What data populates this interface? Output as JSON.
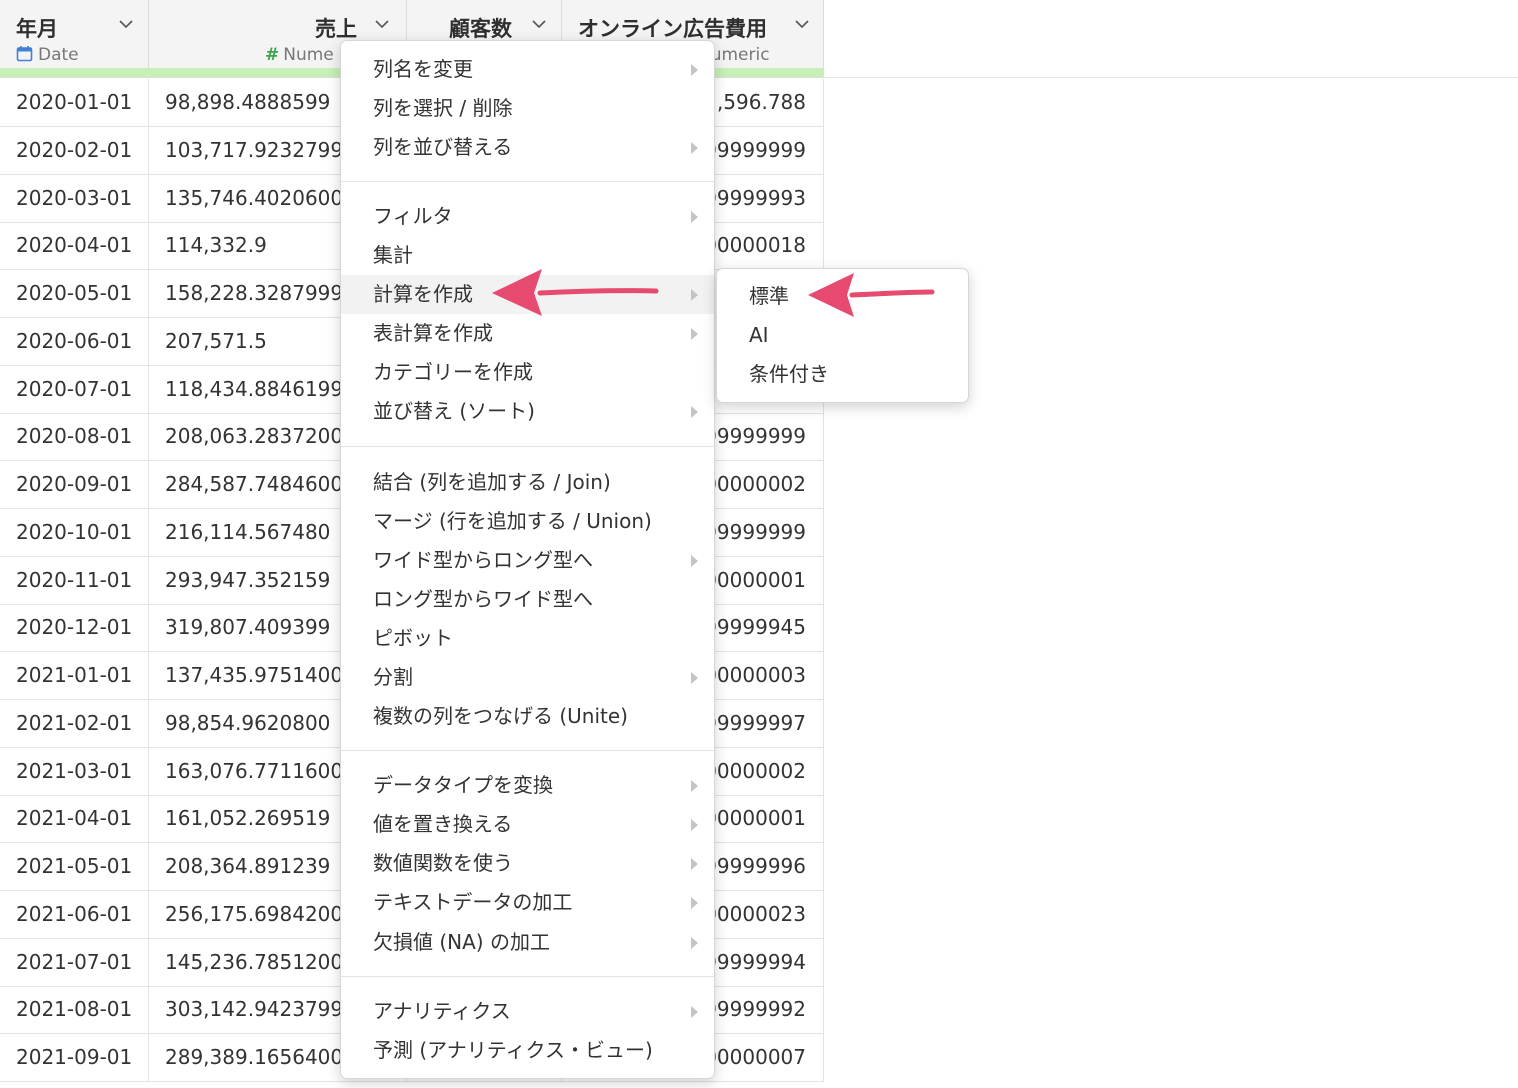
{
  "colors": {
    "accent_arrow": "#e64a6e",
    "type_bar": "#c7efb8",
    "date_icon": "#3f7fd6",
    "numeric_icon": "#3fa54a"
  },
  "columns": [
    {
      "name": "年月",
      "type": "Date",
      "icon": "calendar-icon"
    },
    {
      "name": "売上",
      "type": "Nume",
      "icon": "hash-icon"
    },
    {
      "name": "顧客数",
      "type": "",
      "icon": ""
    },
    {
      "name": "オンライン広告費用",
      "type": "Numeric",
      "icon": ""
    }
  ],
  "rows": [
    {
      "date": "2020-01-01",
      "sales": "98,898.4888599",
      "ad": ",596.788"
    },
    {
      "date": "2020-02-01",
      "sales": "103,717.9232799",
      "ad": "99999999"
    },
    {
      "date": "2020-03-01",
      "sales": "135,746.4020600",
      "ad": "99999993"
    },
    {
      "date": "2020-04-01",
      "sales": "114,332.9",
      "ad": "00000018"
    },
    {
      "date": "2020-05-01",
      "sales": "158,228.3287999",
      "ad": ""
    },
    {
      "date": "2020-06-01",
      "sales": "207,571.5",
      "ad": ""
    },
    {
      "date": "2020-07-01",
      "sales": "118,434.8846199",
      "ad": ""
    },
    {
      "date": "2020-08-01",
      "sales": "208,063.2837200",
      "ad": "99999999"
    },
    {
      "date": "2020-09-01",
      "sales": "284,587.7484600",
      "ad": "00000002"
    },
    {
      "date": "2020-10-01",
      "sales": "216,114.567480",
      "ad": "99999999"
    },
    {
      "date": "2020-11-01",
      "sales": "293,947.352159",
      "ad": "00000001"
    },
    {
      "date": "2020-12-01",
      "sales": "319,807.409399",
      "ad": "99999945"
    },
    {
      "date": "2021-01-01",
      "sales": "137,435.9751400",
      "ad": "00000003"
    },
    {
      "date": "2021-02-01",
      "sales": "98,854.9620800",
      "ad": "99999997"
    },
    {
      "date": "2021-03-01",
      "sales": "163,076.7711600",
      "ad": "00000002"
    },
    {
      "date": "2021-04-01",
      "sales": "161,052.269519",
      "ad": "00000001"
    },
    {
      "date": "2021-05-01",
      "sales": "208,364.891239",
      "ad": "99999996"
    },
    {
      "date": "2021-06-01",
      "sales": "256,175.6984200",
      "ad": "00000023"
    },
    {
      "date": "2021-07-01",
      "sales": "145,236.7851200",
      "ad": "99999994"
    },
    {
      "date": "2021-08-01",
      "sales": "303,142.9423799",
      "ad": "99999992"
    },
    {
      "date": "2021-09-01",
      "sales": "289,389.1656400",
      "ad": "00000007"
    }
  ],
  "menu": {
    "items": [
      {
        "label": "列名を変更",
        "submenu": true
      },
      {
        "label": "列を選択 / 削除",
        "submenu": false
      },
      {
        "label": "列を並び替える",
        "submenu": true
      },
      {
        "label": "フィルタ",
        "submenu": true
      },
      {
        "label": "集計",
        "submenu": false
      },
      {
        "label": "計算を作成",
        "submenu": true,
        "highlighted": true
      },
      {
        "label": "表計算を作成",
        "submenu": true
      },
      {
        "label": "カテゴリーを作成",
        "submenu": false
      },
      {
        "label": "並び替え (ソート)",
        "submenu": true
      },
      {
        "label": "結合 (列を追加する / Join)",
        "submenu": false
      },
      {
        "label": "マージ (行を追加する / Union)",
        "submenu": false
      },
      {
        "label": "ワイド型からロング型へ",
        "submenu": true
      },
      {
        "label": "ロング型からワイド型へ",
        "submenu": false
      },
      {
        "label": "ピボット",
        "submenu": false
      },
      {
        "label": "分割",
        "submenu": true
      },
      {
        "label": "複数の列をつなげる (Unite)",
        "submenu": false
      },
      {
        "label": "データタイプを変換",
        "submenu": true
      },
      {
        "label": "値を置き換える",
        "submenu": true
      },
      {
        "label": "数値関数を使う",
        "submenu": true
      },
      {
        "label": "テキストデータの加工",
        "submenu": true
      },
      {
        "label": "欠損値 (NA) の加工",
        "submenu": true
      },
      {
        "label": "アナリティクス",
        "submenu": true
      },
      {
        "label": "予測 (アナリティクス・ビュー)",
        "submenu": false
      }
    ]
  },
  "submenu": {
    "items": [
      {
        "label": "標準"
      },
      {
        "label": "AI"
      },
      {
        "label": "条件付き"
      }
    ]
  }
}
